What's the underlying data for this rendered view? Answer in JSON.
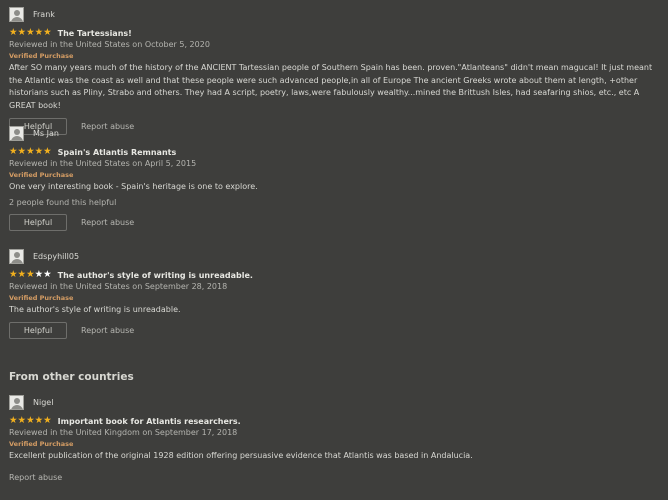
{
  "reviews": [
    {
      "reviewer": "Frank",
      "rating": 5,
      "title": "The Tartessians!",
      "meta": "Reviewed in the United States on October 5, 2020",
      "verified": "Verified Purchase",
      "body": "After SO many years much of the history of the ANCIENT Tartessian people of Southern Spain has been. proven.\"Atlanteans\" didn't mean magucal! It just meant the Atlantic was the coast as well and that these people were such advanced people,in all of Europe The ancient Greeks wrote about them at length, +other historians such as Pliny, Strabo and others. They had A script, poetry, laws,were fabulously wealthy...mined the Brittush Isles, had seafaring shios, etc., etc A GREAT book!",
      "helpful_count": "",
      "helpful_label": "Helpful",
      "report_label": "Report abuse"
    },
    {
      "reviewer": "Ms Jan",
      "rating": 5,
      "title": "Spain's Atlantis Remnants",
      "meta": "Reviewed in the United States on April 5, 2015",
      "verified": "Verified Purchase",
      "body": "One very interesting book - Spain's heritage is one to explore.",
      "helpful_count": "2 people found this helpful",
      "helpful_label": "Helpful",
      "report_label": "Report abuse"
    },
    {
      "reviewer": "Edspyhill05",
      "rating": 3,
      "title": "The author's style of writing is unreadable.",
      "meta": "Reviewed in the United States on September 28, 2018",
      "verified": "Verified Purchase",
      "body": "The author's style of writing is unreadable.",
      "helpful_count": "",
      "helpful_label": "Helpful",
      "report_label": "Report abuse"
    }
  ],
  "other_countries": {
    "heading": "From other countries",
    "review": {
      "reviewer": "Nigel",
      "rating": 5,
      "title": "Important book for Atlantis researchers.",
      "meta": "Reviewed in the United Kingdom on September 17, 2018",
      "verified": "Verified Purchase",
      "body": "Excellent publication of the original 1928 edition offering persuasive evidence that Atlantis was based in Andalucia.",
      "report_label": "Report abuse"
    }
  },
  "colors": {
    "background": "#3e3e3c",
    "star_filled": "#f2b01e",
    "star_empty": "#ffffff",
    "verified": "#d59d64"
  },
  "icons": {
    "avatar": "default-avatar-icon",
    "star": "star-icon"
  }
}
